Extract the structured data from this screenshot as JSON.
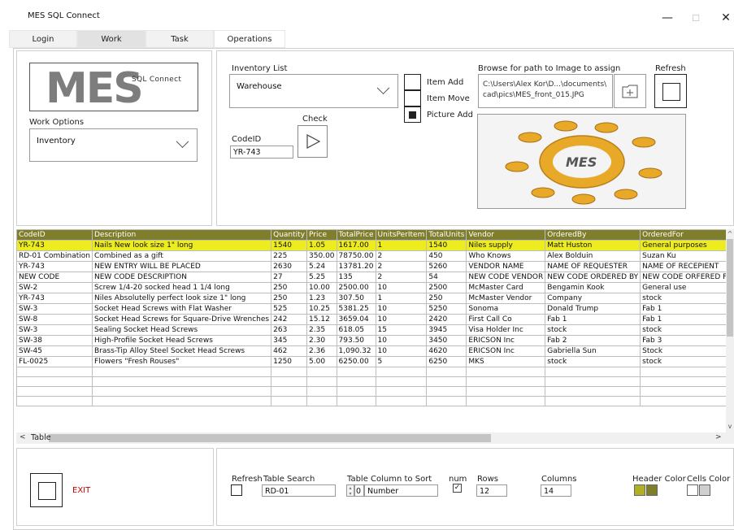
{
  "window": {
    "title": "MES SQL Connect",
    "min_symbol": "—",
    "max_symbol": "☐",
    "close_symbol": "✕"
  },
  "tabs": [
    {
      "label": "Login"
    },
    {
      "label": "Work"
    },
    {
      "label": "Task"
    },
    {
      "label": "Operations"
    }
  ],
  "logo": {
    "main": "MES",
    "sub": "SQL Connect"
  },
  "work_options": {
    "label": "Work Options",
    "value": "Inventory"
  },
  "inventory": {
    "label": "Inventory List",
    "value": "Warehouse"
  },
  "check": {
    "label": "Check"
  },
  "codeid": {
    "label": "CodeID",
    "value": "YR-743"
  },
  "options": {
    "item_add": "Item Add",
    "item_move": "Item Move",
    "picture_add": "Picture Add",
    "picture_add_checked": true
  },
  "browse": {
    "label": "Browse for path to Image to assign",
    "path_line1": "C:\\Users\\Alex Kor\\D...\\documents\\",
    "path_line2": "cad\\pics\\MES_front_015.JPG"
  },
  "refresh": {
    "label": "Refresh"
  },
  "image": {
    "center_text": "MES"
  },
  "table": {
    "caption": "Table",
    "columns": [
      "CodeID",
      "Description",
      "Quantity",
      "Price",
      "TotalPrice",
      "UnitsPerItem",
      "TotalUnits",
      "Vendor",
      "OrderedBy",
      "OrderedFor"
    ],
    "rows": [
      [
        "YR-743",
        "Nails New look size 1\" long",
        "1540",
        "1.05",
        "1617.00",
        "1",
        "1540",
        "Niles supply",
        "Matt Huston",
        "General purposes"
      ],
      [
        "RD-01 Combination",
        "Combined as a gift",
        "225",
        "350.00",
        "78750.00",
        "2",
        "450",
        "Who Knows",
        "Alex Bolduin",
        "Suzan Ku"
      ],
      [
        "YR-743",
        "NEW ENTRY WILL BE PLACED",
        "2630",
        "5.24",
        "13781.20",
        "2",
        "5260",
        "VENDOR NAME",
        "NAME OF REQUESTER",
        "NAME OF RECEPIENT"
      ],
      [
        "NEW CODE",
        "NEW CODE DESCRIPTION",
        "27",
        "5.25",
        "135",
        "2",
        "54",
        "NEW CODE VENDOR",
        "NEW CODE ORDERED BY",
        "NEW CODE ORFERED FOR"
      ],
      [
        "SW-2",
        "Screw 1/4-20 socked head  1 1/4 long",
        "250",
        "10.00",
        "2500.00",
        "10",
        "2500",
        "McMaster Card",
        "Bengamin Kook",
        "General use"
      ],
      [
        "YR-743",
        "Niles Absolutelly perfect look size 1\" long",
        "250",
        "1.23",
        "307.50",
        "1",
        "250",
        "McMaster Vendor",
        "Company",
        "stock"
      ],
      [
        "SW-3",
        "Socket Head Screws with Flat Washer",
        "525",
        "10.25",
        "5381.25",
        "10",
        "5250",
        "Sonoma",
        "Donald Trump",
        "Fab 1"
      ],
      [
        "SW-8",
        "Socket Head Screws for Square-Drive Wrenches",
        "242",
        "15.12",
        "3659.04",
        "10",
        "2420",
        "First Call Co",
        "Fab 1",
        "Fab 1"
      ],
      [
        "SW-3",
        "Sealing Socket Head Screws",
        "263",
        "2.35",
        "618.05",
        "15",
        "3945",
        "Visa Holder Inc",
        "stock",
        "stock"
      ],
      [
        "SW-38",
        "High-Profile Socket Head Screws",
        "345",
        "2.30",
        "793.50",
        "10",
        "3450",
        "ERICSON Inc",
        "Fab 2",
        "Fab 3"
      ],
      [
        "SW-45",
        "Brass-Tip Alloy Steel Socket Head Screws",
        "462",
        "2.36",
        "1,090.32",
        "10",
        "4620",
        "ERICSON Inc",
        "Gabriella Sun",
        "Stock"
      ],
      [
        "FL-0025",
        "Flowers \"Fresh Rouses\"",
        "1250",
        "5.00",
        "6250.00",
        "5",
        "6250",
        "MKS",
        "stock",
        "stock"
      ],
      [
        "",
        "",
        "",
        "",
        "",
        "",
        "",
        "",
        "",
        ""
      ],
      [
        "",
        "",
        "",
        "",
        "",
        "",
        "",
        "",
        "",
        ""
      ],
      [
        "",
        "",
        "",
        "",
        "",
        "",
        "",
        "",
        "",
        ""
      ],
      [
        "",
        "",
        "",
        "",
        "",
        "",
        "",
        "",
        "",
        ""
      ]
    ],
    "selected_row": 0
  },
  "bottom": {
    "exit_label": "EXIT",
    "refresh_label": "Refresh",
    "search_label": "Table Search",
    "search_value": "RD-01",
    "sort_label": "Table Column to Sort",
    "sort_index": "0",
    "sort_value": "Number",
    "num_label": "num",
    "num_checked": true,
    "rows_label": "Rows",
    "rows_value": "12",
    "columns_label": "Columns",
    "columns_value": "14",
    "header_color_label": "Header Color",
    "cells_color_label": "Cells Color",
    "header_colors": [
      "#b0b020",
      "#7f7f2b"
    ],
    "cells_colors": [
      "#ffffff",
      "#cfcfcf"
    ]
  }
}
